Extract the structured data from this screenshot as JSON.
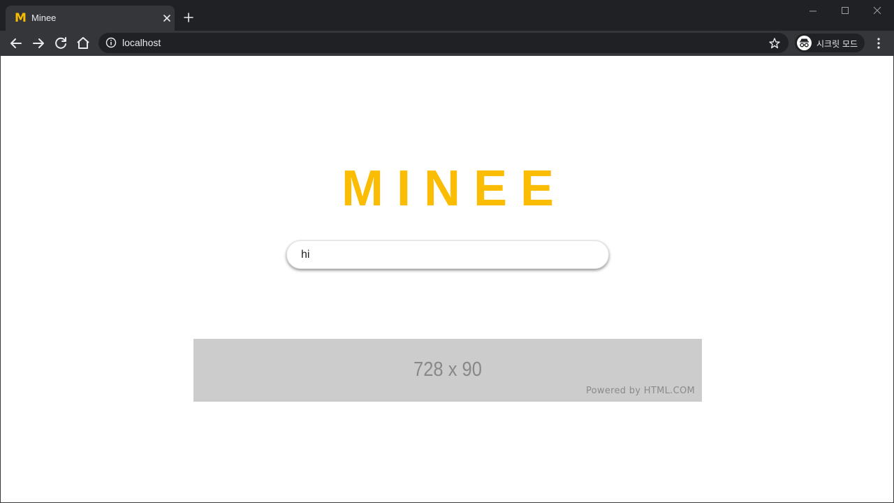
{
  "browser": {
    "tab": {
      "favicon_letter": "M",
      "title": "Minee"
    },
    "address": {
      "url": "localhost"
    },
    "incognito": {
      "label": "시크릿 모드"
    },
    "icons": {
      "back": "arrow-left-icon",
      "forward": "arrow-right-icon",
      "reload": "reload-icon",
      "home": "home-icon",
      "info": "info-icon",
      "bookmark": "star-icon",
      "menu": "vertical-dots-icon",
      "tab_close": "close-icon",
      "new_tab": "plus-icon",
      "window_minimize": "minimize-icon",
      "window_maximize": "maximize-icon",
      "window_close": "close-icon"
    }
  },
  "page": {
    "logo": "MINEE",
    "search": {
      "value": "hi",
      "placeholder": ""
    },
    "ad": {
      "size_label": "728 x 90",
      "powered_by": "Powered by HTML.COM"
    }
  },
  "colors": {
    "brand": "#fbbc04",
    "chrome_dark": "#202124",
    "chrome_toolbar": "#35363a",
    "ad_background": "#cccccc"
  }
}
